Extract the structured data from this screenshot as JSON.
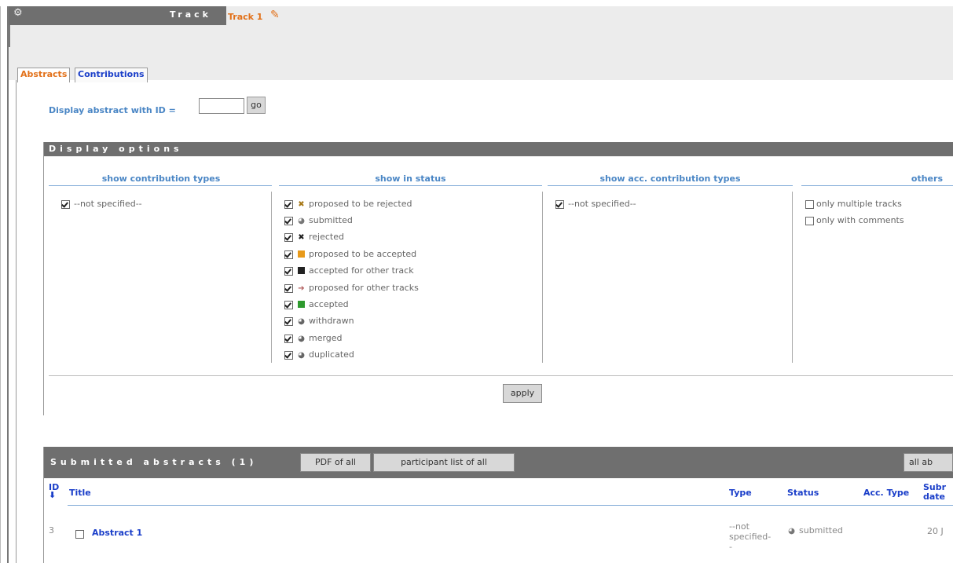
{
  "header": {
    "section_label": "Track",
    "track_name": "Track 1"
  },
  "tabs": [
    {
      "label": "Abstracts",
      "active": true
    },
    {
      "label": "Contributions",
      "active": false
    }
  ],
  "display_id": {
    "label": "Display abstract with ID =",
    "value": "",
    "go_label": "go"
  },
  "display_options": {
    "title": "Display options",
    "columns": {
      "contribution_types": {
        "heading": "show contribution types",
        "items": [
          {
            "label": "--not specified--",
            "checked": true
          }
        ]
      },
      "status": {
        "heading": "show in status",
        "items": [
          {
            "label": "proposed to be rejected",
            "checked": true,
            "icon": "proposed-rejected-icon"
          },
          {
            "label": "submitted",
            "checked": true,
            "icon": "submitted-icon"
          },
          {
            "label": "rejected",
            "checked": true,
            "icon": "rejected-icon"
          },
          {
            "label": "proposed to be accepted",
            "checked": true,
            "icon": "proposed-accepted-icon"
          },
          {
            "label": "accepted for other track",
            "checked": true,
            "icon": "accepted-other-track-icon"
          },
          {
            "label": "proposed for other tracks",
            "checked": true,
            "icon": "proposed-other-tracks-icon"
          },
          {
            "label": "accepted",
            "checked": true,
            "icon": "accepted-icon"
          },
          {
            "label": "withdrawn",
            "checked": true,
            "icon": "withdrawn-icon"
          },
          {
            "label": "merged",
            "checked": true,
            "icon": "merged-icon"
          },
          {
            "label": "duplicated",
            "checked": true,
            "icon": "duplicated-icon"
          }
        ]
      },
      "acc_contribution_types": {
        "heading": "show acc. contribution types",
        "items": [
          {
            "label": "--not specified--",
            "checked": true
          }
        ]
      },
      "others": {
        "heading": "others",
        "items": [
          {
            "label": "only multiple tracks",
            "checked": false
          },
          {
            "label": "only with comments",
            "checked": false
          }
        ]
      }
    },
    "apply_label": "apply"
  },
  "submitted": {
    "title": "Submitted abstracts (1)",
    "pdf_label": "PDF of all",
    "participant_label": "participant list of all",
    "all_label": "all ab",
    "columns": {
      "id": "ID",
      "title": "Title",
      "type": "Type",
      "status": "Status",
      "acc_type": "Acc. Type",
      "sub_date_1": "Subr",
      "sub_date_2": "date"
    },
    "rows": [
      {
        "id": "3",
        "title": "Abstract 1",
        "type_lines": [
          "--not",
          "specified-",
          "-"
        ],
        "status": "submitted",
        "date": "20 J"
      }
    ]
  },
  "colors": {
    "header_bg": "#6f6f6f",
    "accent_orange": "#e2711a",
    "link_blue": "#1a3ec9",
    "heading_blue": "#4a86c5"
  }
}
